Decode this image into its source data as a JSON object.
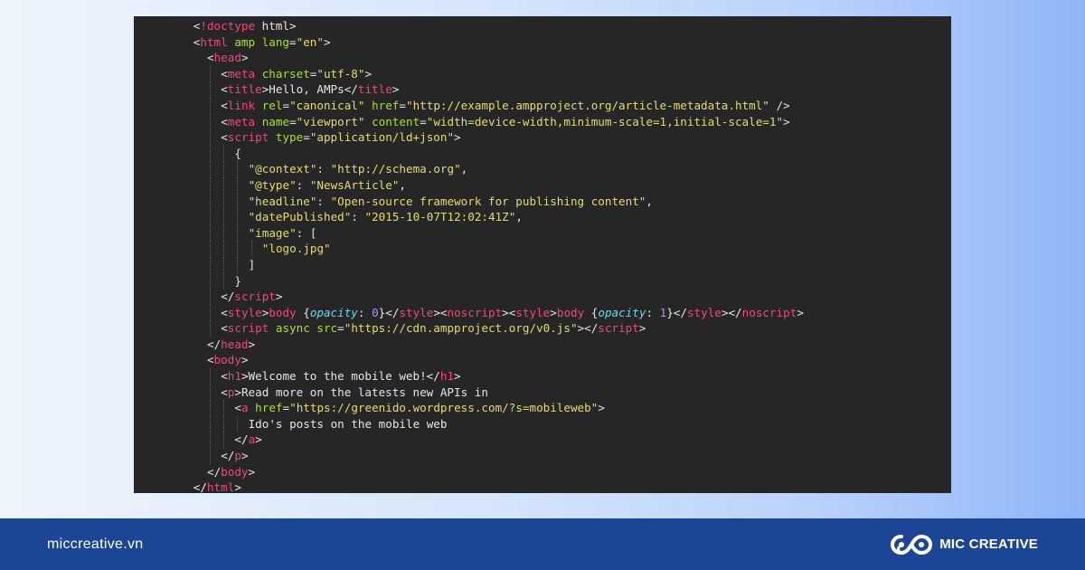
{
  "code": {
    "lines": [
      [
        {
          "t": "<",
          "c": "p"
        },
        {
          "t": "!doctype",
          "c": "t"
        },
        {
          "t": " html>",
          "c": "p"
        }
      ],
      [
        {
          "t": "<",
          "c": "p"
        },
        {
          "t": "html",
          "c": "t"
        },
        {
          "t": " ",
          "c": "p"
        },
        {
          "t": "amp",
          "c": "a"
        },
        {
          "t": " ",
          "c": "p"
        },
        {
          "t": "lang",
          "c": "a"
        },
        {
          "t": "=",
          "c": "p"
        },
        {
          "t": "\"en\"",
          "c": "s"
        },
        {
          "t": ">",
          "c": "p"
        }
      ],
      [
        {
          "t": "<",
          "c": "p"
        },
        {
          "t": "head",
          "c": "t"
        },
        {
          "t": ">",
          "c": "p"
        }
      ],
      [
        {
          "t": "<",
          "c": "p"
        },
        {
          "t": "meta",
          "c": "t"
        },
        {
          "t": " ",
          "c": "p"
        },
        {
          "t": "charset",
          "c": "a"
        },
        {
          "t": "=",
          "c": "p"
        },
        {
          "t": "\"utf-8\"",
          "c": "s"
        },
        {
          "t": ">",
          "c": "p"
        }
      ],
      [
        {
          "t": "<",
          "c": "p"
        },
        {
          "t": "title",
          "c": "t"
        },
        {
          "t": ">Hello, AMPs</",
          "c": "p"
        },
        {
          "t": "title",
          "c": "t"
        },
        {
          "t": ">",
          "c": "p"
        }
      ],
      [
        {
          "t": "<",
          "c": "p"
        },
        {
          "t": "link",
          "c": "t"
        },
        {
          "t": " ",
          "c": "p"
        },
        {
          "t": "rel",
          "c": "a"
        },
        {
          "t": "=",
          "c": "p"
        },
        {
          "t": "\"canonical\"",
          "c": "s"
        },
        {
          "t": " ",
          "c": "p"
        },
        {
          "t": "href",
          "c": "a"
        },
        {
          "t": "=",
          "c": "p"
        },
        {
          "t": "\"http://example.ampproject.org/article-metadata.html\"",
          "c": "s"
        },
        {
          "t": " />",
          "c": "p"
        }
      ],
      [
        {
          "t": "<",
          "c": "p"
        },
        {
          "t": "meta",
          "c": "t"
        },
        {
          "t": " ",
          "c": "p"
        },
        {
          "t": "name",
          "c": "a"
        },
        {
          "t": "=",
          "c": "p"
        },
        {
          "t": "\"viewport\"",
          "c": "s"
        },
        {
          "t": " ",
          "c": "p"
        },
        {
          "t": "content",
          "c": "a"
        },
        {
          "t": "=",
          "c": "p"
        },
        {
          "t": "\"width=device-width,minimum-scale=1,initial-scale=1\"",
          "c": "s"
        },
        {
          "t": ">",
          "c": "p"
        }
      ],
      [
        {
          "t": "<",
          "c": "p"
        },
        {
          "t": "script",
          "c": "t"
        },
        {
          "t": " ",
          "c": "p"
        },
        {
          "t": "type",
          "c": "a"
        },
        {
          "t": "=",
          "c": "p"
        },
        {
          "t": "\"application/ld+json\"",
          "c": "s"
        },
        {
          "t": ">",
          "c": "p"
        }
      ],
      [
        {
          "t": "{",
          "c": "j"
        }
      ],
      [
        {
          "t": "\"@context\"",
          "c": "s"
        },
        {
          "t": ": ",
          "c": "p"
        },
        {
          "t": "\"http://schema.org\"",
          "c": "s"
        },
        {
          "t": ",",
          "c": "p"
        }
      ],
      [
        {
          "t": "\"@type\"",
          "c": "s"
        },
        {
          "t": ": ",
          "c": "p"
        },
        {
          "t": "\"NewsArticle\"",
          "c": "s"
        },
        {
          "t": ",",
          "c": "p"
        }
      ],
      [
        {
          "t": "\"headline\"",
          "c": "s"
        },
        {
          "t": ": ",
          "c": "p"
        },
        {
          "t": "\"Open-source framework for publishing content\"",
          "c": "s"
        },
        {
          "t": ",",
          "c": "p"
        }
      ],
      [
        {
          "t": "\"datePublished\"",
          "c": "s"
        },
        {
          "t": ": ",
          "c": "p"
        },
        {
          "t": "\"2015-10-07T12:02:41Z\"",
          "c": "s"
        },
        {
          "t": ",",
          "c": "p"
        }
      ],
      [
        {
          "t": "\"image\"",
          "c": "s"
        },
        {
          "t": ": [",
          "c": "p"
        }
      ],
      [
        {
          "t": "\"logo.jpg\"",
          "c": "s"
        }
      ],
      [
        {
          "t": "]",
          "c": "p"
        }
      ],
      [
        {
          "t": "}",
          "c": "j"
        }
      ],
      [
        {
          "t": "</",
          "c": "p"
        },
        {
          "t": "script",
          "c": "t"
        },
        {
          "t": ">",
          "c": "p"
        }
      ],
      [
        {
          "t": "<",
          "c": "p"
        },
        {
          "t": "style",
          "c": "t"
        },
        {
          "t": ">",
          "c": "p"
        },
        {
          "t": "body",
          "c": "t"
        },
        {
          "t": " {",
          "c": "p"
        },
        {
          "t": "opacity",
          "c": "k"
        },
        {
          "t": ": ",
          "c": "p"
        },
        {
          "t": "0",
          "c": "n"
        },
        {
          "t": "}</",
          "c": "p"
        },
        {
          "t": "style",
          "c": "t"
        },
        {
          "t": "><",
          "c": "p"
        },
        {
          "t": "noscript",
          "c": "t"
        },
        {
          "t": "><",
          "c": "p"
        },
        {
          "t": "style",
          "c": "t"
        },
        {
          "t": ">",
          "c": "p"
        },
        {
          "t": "body",
          "c": "t"
        },
        {
          "t": " {",
          "c": "p"
        },
        {
          "t": "opacity",
          "c": "k"
        },
        {
          "t": ": ",
          "c": "p"
        },
        {
          "t": "1",
          "c": "n"
        },
        {
          "t": "}</",
          "c": "p"
        },
        {
          "t": "style",
          "c": "t"
        },
        {
          "t": "></",
          "c": "p"
        },
        {
          "t": "noscript",
          "c": "t"
        },
        {
          "t": ">",
          "c": "p"
        }
      ],
      [
        {
          "t": "<",
          "c": "p"
        },
        {
          "t": "script",
          "c": "t"
        },
        {
          "t": " ",
          "c": "p"
        },
        {
          "t": "async",
          "c": "a"
        },
        {
          "t": " ",
          "c": "p"
        },
        {
          "t": "src",
          "c": "a"
        },
        {
          "t": "=",
          "c": "p"
        },
        {
          "t": "\"https://cdn.ampproject.org/v0.js\"",
          "c": "s"
        },
        {
          "t": "></",
          "c": "p"
        },
        {
          "t": "script",
          "c": "t"
        },
        {
          "t": ">",
          "c": "p"
        }
      ],
      [
        {
          "t": "</",
          "c": "p"
        },
        {
          "t": "head",
          "c": "t"
        },
        {
          "t": ">",
          "c": "p"
        }
      ],
      [
        {
          "t": "<",
          "c": "p"
        },
        {
          "t": "body",
          "c": "t"
        },
        {
          "t": ">",
          "c": "p"
        }
      ],
      [
        {
          "t": "<",
          "c": "p"
        },
        {
          "t": "h1",
          "c": "t"
        },
        {
          "t": ">Welcome to the mobile web!</",
          "c": "p"
        },
        {
          "t": "h1",
          "c": "t"
        },
        {
          "t": ">",
          "c": "p"
        }
      ],
      [
        {
          "t": "<",
          "c": "p"
        },
        {
          "t": "p",
          "c": "t"
        },
        {
          "t": ">Read more on the latests new APIs in",
          "c": "p"
        }
      ],
      [
        {
          "t": "<",
          "c": "p"
        },
        {
          "t": "a",
          "c": "t"
        },
        {
          "t": " ",
          "c": "p"
        },
        {
          "t": "href",
          "c": "a"
        },
        {
          "t": "=",
          "c": "p"
        },
        {
          "t": "\"https://greenido.wordpress.com/?s=mobileweb\"",
          "c": "s"
        },
        {
          "t": ">",
          "c": "p"
        }
      ],
      [
        {
          "t": "Ido's posts on the mobile web",
          "c": "p"
        }
      ],
      [
        {
          "t": "</",
          "c": "p"
        },
        {
          "t": "a",
          "c": "t"
        },
        {
          "t": ">",
          "c": "p"
        }
      ],
      [
        {
          "t": "</",
          "c": "p"
        },
        {
          "t": "p",
          "c": "t"
        },
        {
          "t": ">",
          "c": "p"
        }
      ],
      [
        {
          "t": "</",
          "c": "p"
        },
        {
          "t": "body",
          "c": "t"
        },
        {
          "t": ">",
          "c": "p"
        }
      ],
      [
        {
          "t": "</",
          "c": "p"
        },
        {
          "t": "html",
          "c": "t"
        },
        {
          "t": ">",
          "c": "p"
        }
      ]
    ]
  },
  "colors": {
    "panel_background": "#262626",
    "tag": "#f0487a",
    "attribute": "#a6e22e",
    "string": "#e6db74",
    "number": "#b48ef7",
    "property": "#66d9ef",
    "plain": "#e6e6e6",
    "footer_background": "#1d4596"
  },
  "footer": {
    "website": "miccreative.vn",
    "brand_name": "MIC CREATIVE",
    "brand_icon": "infinity-logo-icon"
  }
}
